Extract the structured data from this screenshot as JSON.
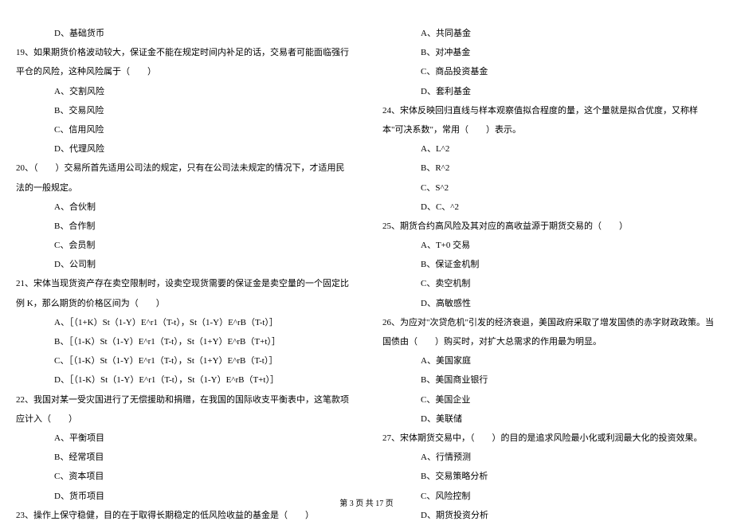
{
  "left": {
    "q18_optD": "D、基础货币",
    "q19_text": "19、如果期货价格波动较大，保证金不能在规定时间内补足的话，交易者可能面临强行平仓的风险，这种风险属于（　　）",
    "q19_optA": "A、交割风险",
    "q19_optB": "B、交易风险",
    "q19_optC": "C、信用风险",
    "q19_optD": "D、代理风险",
    "q20_text": "20、（　　）交易所首先适用公司法的规定，只有在公司法未规定的情况下，才适用民法的一般规定。",
    "q20_optA": "A、合伙制",
    "q20_optB": "B、合作制",
    "q20_optC": "C、会员制",
    "q20_optD": "D、公司制",
    "q21_text": "21、宋体当现货资产存在卖空限制时，设卖空现货需要的保证金是卖空量的一个固定比例 K，那么期货的价格区间为（　　）",
    "q21_optA": "A、［（1+K）St（1-Y）E^r1（T-t），St（1-Y）E^rB（T-t）］",
    "q21_optB": "B、［（1-K）St（1-Y）E^r1（T-t），St（1+Y）E^rB（T+t）］",
    "q21_optC": "C、［（1-K）St（1-Y）E^r1（T-t），St（1+Y）E^rB（T-t）］",
    "q21_optD": "D、［（1-K）St（1-Y）E^r1（T-t），St（1-Y）E^rB（T+t）］",
    "q22_text": "22、我国对某一受灾国进行了无偿援助和捐赠，在我国的国际收支平衡表中，这笔款项应计入（　　）",
    "q22_optA": "A、平衡项目",
    "q22_optB": "B、经常项目",
    "q22_optC": "C、资本项目",
    "q22_optD": "D、货币项目",
    "q23_text": "23、操作上保守稳健，目的在于取得长期稳定的低风险收益的基金是（　　）"
  },
  "right": {
    "q23_optA": "A、共同基金",
    "q23_optB": "B、对冲基金",
    "q23_optC": "C、商品投资基金",
    "q23_optD": "D、套利基金",
    "q24_text": "24、宋体反映回归直线与样本观察值拟合程度的量，这个量就是拟合优度，又称样本\"可决系数\"，常用（　　）表示。",
    "q24_optA": "A、L^2",
    "q24_optB": "B、R^2",
    "q24_optC": "C、S^2",
    "q24_optD": "D、C、^2",
    "q25_text": "25、期货合约高风险及其对应的高收益源于期货交易的（　　）",
    "q25_optA": "A、T+0 交易",
    "q25_optB": "B、保证金机制",
    "q25_optC": "C、卖空机制",
    "q25_optD": "D、高敏感性",
    "q26_text": "26、为应对\"次贷危机\"引发的经济衰退，美国政府采取了增发国债的赤字财政政策。当国债由（　　）购买时，对扩大总需求的作用最为明显。",
    "q26_optA": "A、美国家庭",
    "q26_optB": "B、美国商业银行",
    "q26_optC": "C、美国企业",
    "q26_optD": "D、美联储",
    "q27_text": "27、宋体期货交易中，（　　）的目的是追求风险最小化或利润最大化的投资效果。",
    "q27_optA": "A、行情预测",
    "q27_optB": "B、交易策略分析",
    "q27_optC": "C、风险控制",
    "q27_optD": "D、期货投资分析"
  },
  "footer": "第 3 页 共 17 页"
}
